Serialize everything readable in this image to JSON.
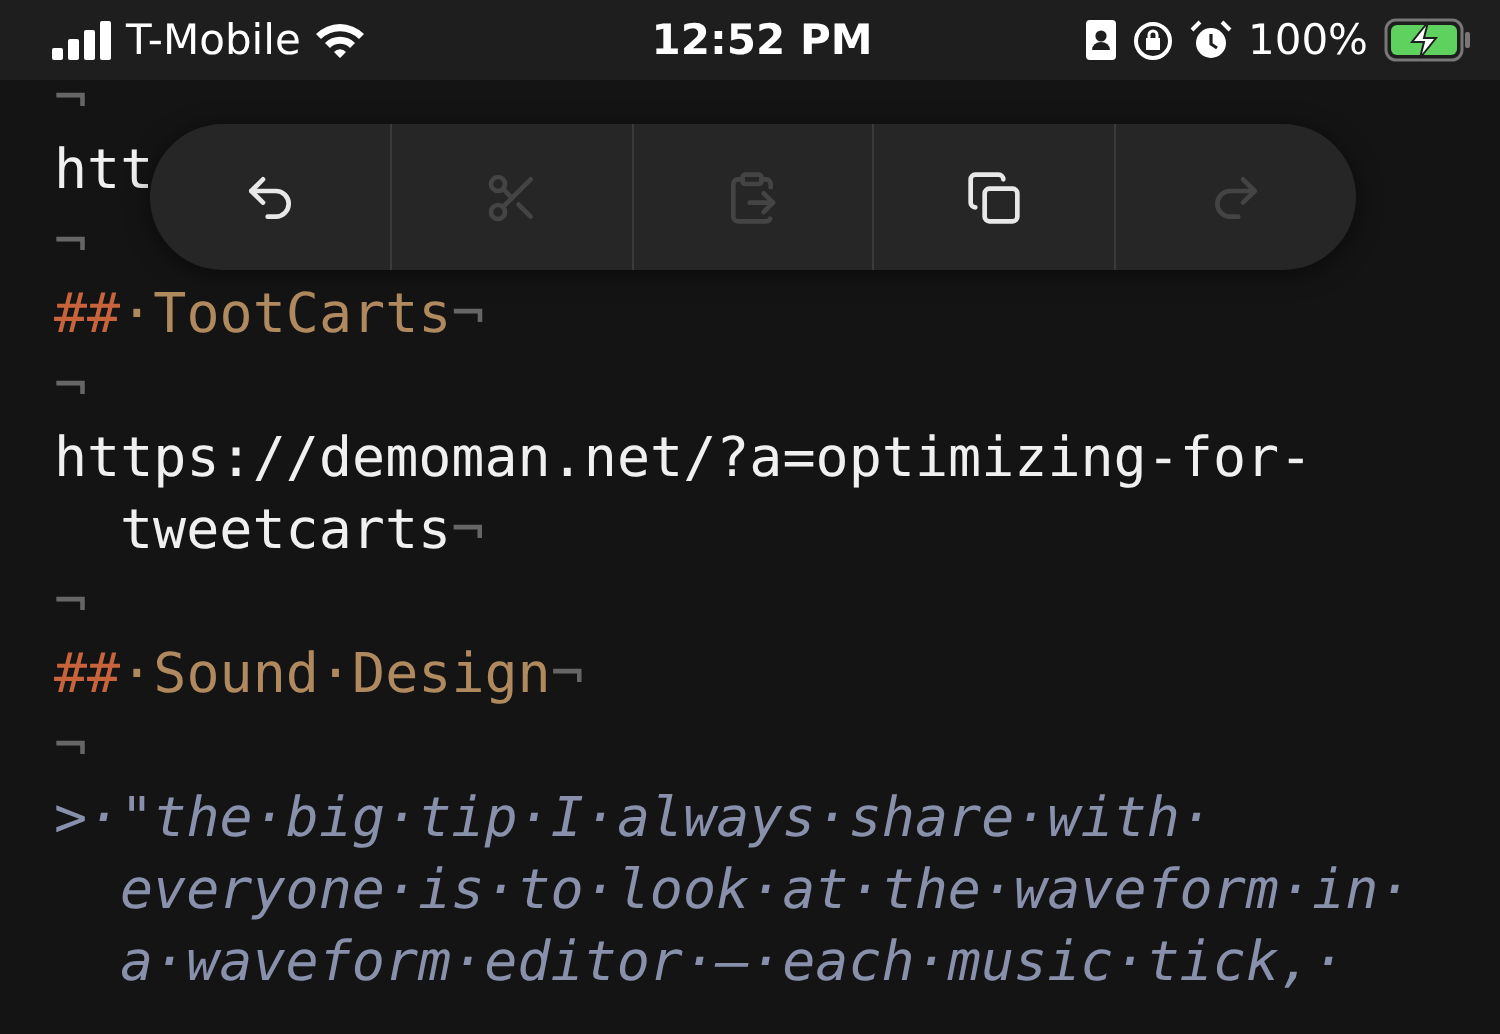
{
  "status_bar": {
    "carrier": "T-Mobile",
    "time": "12:52 PM",
    "battery": "100%",
    "charging": true
  },
  "edit_menu": [
    {
      "kind": "undo",
      "disabled": false
    },
    {
      "kind": "cut",
      "disabled": true
    },
    {
      "kind": "paste",
      "disabled": true
    },
    {
      "kind": "copy",
      "disabled": false
    },
    {
      "kind": "redo",
      "disabled": true
    }
  ],
  "lines": [
    {
      "kind": "blank",
      "end": "¬"
    },
    {
      "kind": "text",
      "rows": [
        "htt"
      ]
    },
    {
      "kind": "blank",
      "end": "¬"
    },
    {
      "kind": "heading",
      "marker": "##",
      "rows": [
        "·TootCarts"
      ],
      "end": "¬"
    },
    {
      "kind": "blank",
      "end": "¬"
    },
    {
      "kind": "text",
      "rows": [
        "https://demoman.net/?a=optimizing-for-",
        "tweetcarts"
      ],
      "end": "¬"
    },
    {
      "kind": "blank",
      "end": "¬"
    },
    {
      "kind": "heading",
      "marker": "##",
      "rows": [
        "·Sound·Design"
      ],
      "end": "¬"
    },
    {
      "kind": "blank",
      "end": "¬"
    },
    {
      "kind": "quote",
      "marker": ">",
      "rows": [
        "·\"the·big·tip·I·always·share·with·",
        "everyone·is·to·look·at·the·waveform·in·",
        "a·waveform·editor·—·each·music·tick,·"
      ]
    }
  ]
}
